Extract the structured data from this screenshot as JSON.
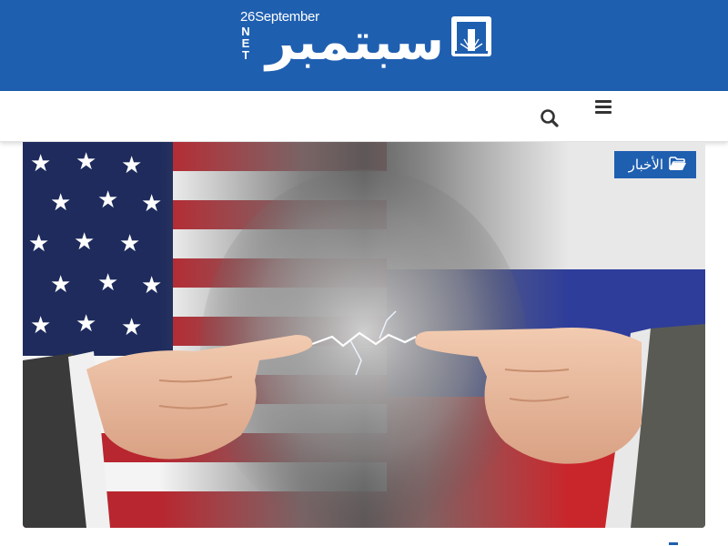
{
  "site": {
    "logo_latin": "26September",
    "logo_net": [
      "N",
      "E",
      "T"
    ],
    "logo_arabic": "سبتمبر",
    "brand_color": "#1f5fb0"
  },
  "nav": {
    "menu_icon": "hamburger-menu-icon",
    "search_icon": "search-icon"
  },
  "article": {
    "category_label": "الأخبار",
    "category_icon": "folder-open-icon",
    "image_subject": "hero-image"
  }
}
